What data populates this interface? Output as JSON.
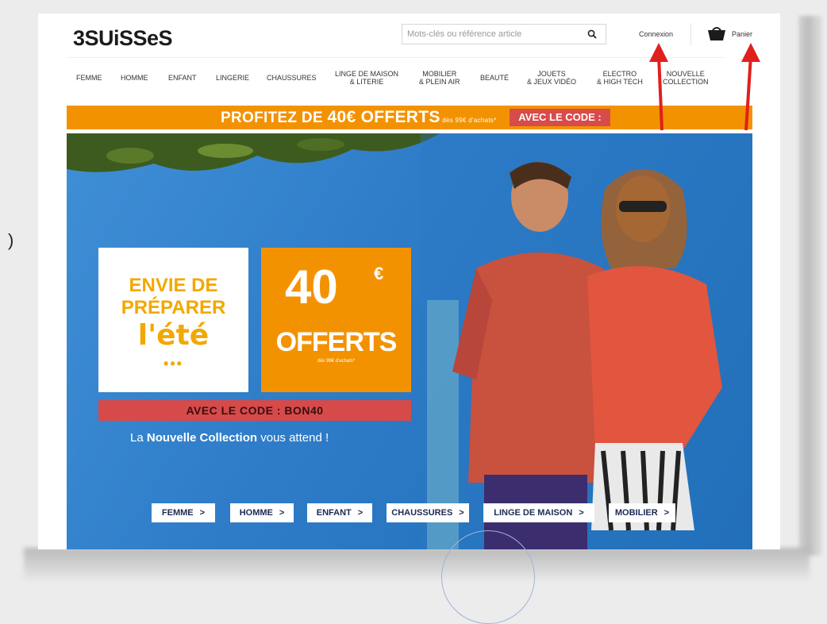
{
  "header": {
    "logo": "3SUiSSeS",
    "search_placeholder": "Mots-clés ou référence article",
    "connexion_label": "Connexion",
    "panier_label": "Panier"
  },
  "nav": {
    "items": [
      {
        "label": "FEMME"
      },
      {
        "label": "HOMME"
      },
      {
        "label": "ENFANT"
      },
      {
        "label": "LINGERIE"
      },
      {
        "label": "CHAUSSURES"
      },
      {
        "label": "LINGE DE MAISON\n& LITERIE"
      },
      {
        "label": "MOBILIER\n& PLEIN AIR"
      },
      {
        "label": "BEAUTÉ"
      },
      {
        "label": "JOUETS\n& JEUX VIDÉO"
      },
      {
        "label": "ELECTRO\n& HIGH TECH"
      },
      {
        "label": "NOUVELLE\nCOLLECTION"
      }
    ]
  },
  "promo": {
    "text_start": "PROFITEZ DE ",
    "amount": "40€ OFFERTS",
    "condition": " dès 99€ d'achats*",
    "code": "AVEC LE CODE : BON40"
  },
  "hero": {
    "tile1": [
      "ENVIE DE",
      "PRÉPARER",
      "l'été",
      "•••"
    ],
    "tile2_number": "40",
    "tile2_currency": "€",
    "tile2_offered": "OFFERTS",
    "tile2_condition": "dès 99€ d'achats*",
    "code_strip": "AVEC LE CODE : BON40",
    "tagline_start": "La ",
    "tagline_bold": "Nouvelle Collection",
    "tagline_end": " vous attend !",
    "buttons": [
      {
        "label": "FEMME",
        "chevron": ">"
      },
      {
        "label": "HOMME",
        "chevron": ">"
      },
      {
        "label": "ENFANT",
        "chevron": ">"
      },
      {
        "label": "CHAUSSURES",
        "chevron": ">"
      },
      {
        "label": "LINGE DE MAISON",
        "chevron": ">"
      },
      {
        "label": "MOBILIER",
        "chevron": ">"
      }
    ]
  },
  "colors": {
    "brand_orange": "#f39200",
    "code_red": "#d84b4b",
    "hero_blue": "#2f7dc9",
    "annotation_red": "#e0201c"
  }
}
